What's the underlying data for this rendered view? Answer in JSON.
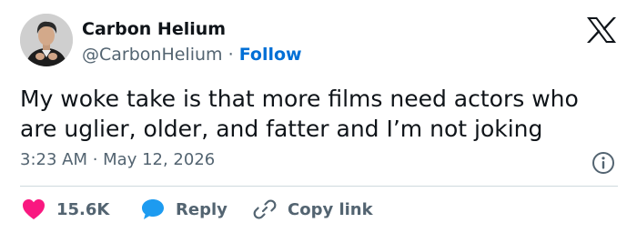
{
  "author": {
    "display_name": "Carbon Helium",
    "handle": "@CarbonHelium",
    "separator": "·",
    "follow_label": "Follow"
  },
  "tweet": {
    "text": "My woke take is that more films need actors who are uglier, older, and fatter and I’m not joking",
    "timestamp": "3:23 AM · May 12, 2026"
  },
  "actions": {
    "like_count": "15.6K",
    "reply_label": "Reply",
    "copy_link_label": "Copy link"
  },
  "icons": {
    "brand": "x-logo-icon",
    "info": "info-icon",
    "like": "heart-icon",
    "reply": "speech-bubble-icon",
    "copy": "link-icon"
  },
  "colors": {
    "link_blue": "#006fd6",
    "heart_red": "#f91880",
    "reply_blue": "#1d9bf0",
    "muted_text": "#536471",
    "primary_text": "#0f1419"
  }
}
